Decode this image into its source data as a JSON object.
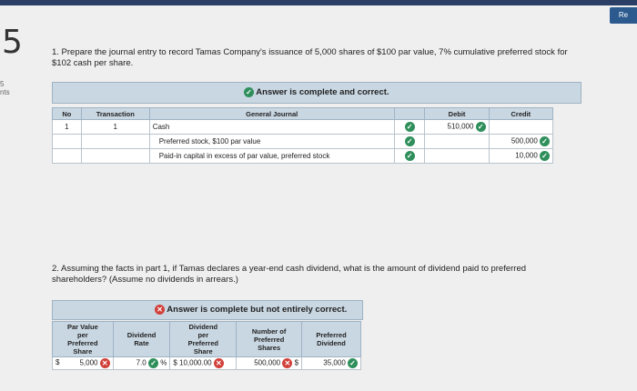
{
  "top_button": "Re",
  "question_number": "5",
  "points": [
    "5",
    "nts"
  ],
  "part1": {
    "prompt_line1": "1. Prepare the journal entry to record Tamas Company's issuance of 5,000 shares of $100 par value, 7% cumulative preferred stock for",
    "prompt_line2": "$102 cash per share.",
    "banner": "Answer is complete and correct.",
    "columns": {
      "no": "No",
      "transaction": "Transaction",
      "general_journal": "General Journal",
      "debit": "Debit",
      "credit": "Credit"
    },
    "rows": [
      {
        "no": "1",
        "transaction": "1",
        "account": "Cash",
        "debit": "510,000",
        "credit": ""
      },
      {
        "no": "",
        "transaction": "",
        "account": "Preferred stock, $100 par value",
        "debit": "",
        "credit": "500,000"
      },
      {
        "no": "",
        "transaction": "",
        "account": "Paid-in capital in excess of par value, preferred stock",
        "debit": "",
        "credit": "10,000"
      }
    ]
  },
  "part2": {
    "prompt_line1": "2. Assuming the facts in part 1, if Tamas declares a year-end cash dividend, what is the amount of dividend paid to preferred",
    "prompt_line2": "shareholders? (Assume no dividends in arrears.)",
    "banner": "Answer is complete but not entirely correct.",
    "columns": {
      "par_value": [
        "Par Value",
        "per",
        "Preferred",
        "Share"
      ],
      "dividend_rate": [
        "Dividend",
        "Rate"
      ],
      "dividend_per_share": [
        "Dividend",
        "per",
        "Preferred",
        "Share"
      ],
      "number_of_shares": [
        "Number of",
        "Preferred",
        "Shares"
      ],
      "preferred_dividend": [
        "Preferred",
        "Dividend"
      ]
    },
    "values": {
      "par_currency": "$",
      "par_value": "5,000",
      "dividend_rate": "7.0",
      "rate_unit": "%",
      "dps_currency": "$",
      "dividend_per_share": "10,000.00",
      "number_of_shares": "500,000",
      "pd_currency": "$",
      "preferred_dividend": "35,000"
    }
  }
}
